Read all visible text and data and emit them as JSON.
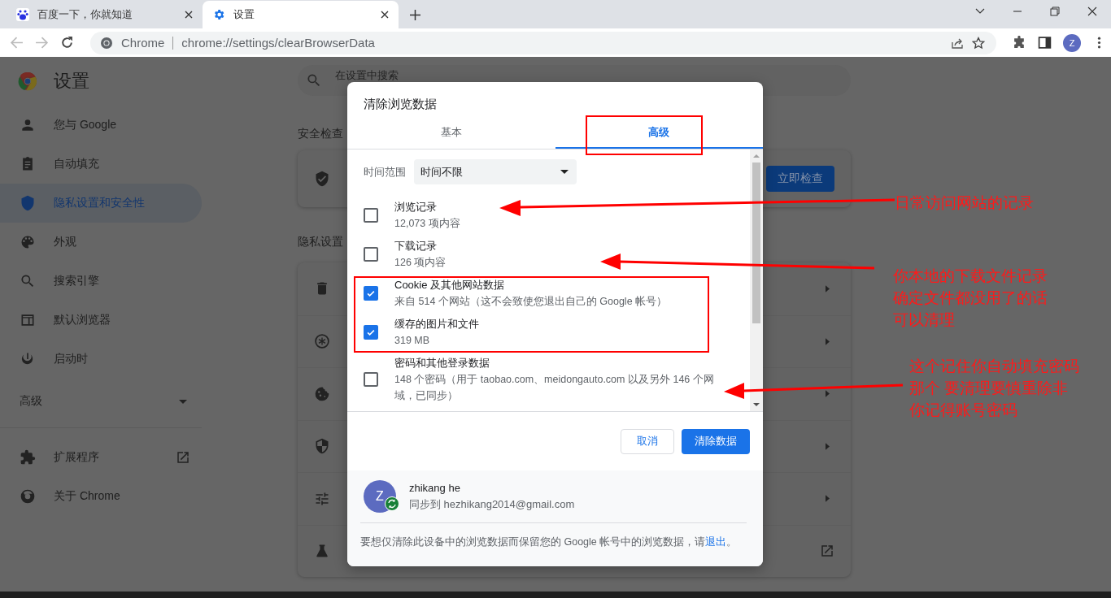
{
  "browser": {
    "tabs": [
      {
        "title": "百度一下，你就知道",
        "kind": "paw",
        "selected": false
      },
      {
        "title": "设置",
        "kind": "gear",
        "selected": true
      }
    ],
    "omnibox": {
      "site": "Chrome",
      "url": "chrome://settings/clearBrowserData"
    },
    "profile_initial": "Z"
  },
  "settings": {
    "title": "设置",
    "search": {
      "placeholder": "在设置中搜索"
    },
    "sidebar": {
      "items": [
        {
          "label": "您与 Google",
          "kind": "person",
          "selected": false
        },
        {
          "label": "自动填充",
          "kind": "clipboard",
          "selected": false
        },
        {
          "label": "隐私设置和安全性",
          "kind": "shield",
          "selected": true
        },
        {
          "label": "外观",
          "kind": "palette",
          "selected": false
        },
        {
          "label": "搜索引擎",
          "kind": "search",
          "selected": false
        },
        {
          "label": "默认浏览器",
          "kind": "browser",
          "selected": false
        },
        {
          "label": "启动时",
          "kind": "power",
          "selected": false
        }
      ],
      "advanced": {
        "label": "高级",
        "expanded": false
      },
      "links": [
        {
          "label": "扩展程序",
          "kind": "puzzle",
          "external": true
        },
        {
          "label": "关于 Chrome",
          "kind": "chrome",
          "external": false
        }
      ]
    },
    "safety_check": {
      "heading": "安全检查",
      "button": "立即检查"
    },
    "privacy": {
      "heading": "隐私设置",
      "rows": [
        {
          "kind": "trash",
          "external": false
        },
        {
          "kind": "asterisk",
          "external": false
        },
        {
          "kind": "cookie",
          "external": false
        },
        {
          "kind": "shield",
          "external": false
        },
        {
          "kind": "sliders",
          "external": false
        },
        {
          "kind": "flask",
          "external": true
        }
      ]
    }
  },
  "dialog": {
    "title": "清除浏览数据",
    "tabs": [
      {
        "label": "基本",
        "selected": false
      },
      {
        "label": "高级",
        "selected": true
      }
    ],
    "time_range": {
      "label": "时间范围",
      "value": "时间不限"
    },
    "items": [
      {
        "title": "浏览记录",
        "detail": "12,073 项内容",
        "checked": false
      },
      {
        "title": "下载记录",
        "detail": "126 项内容",
        "checked": false
      },
      {
        "title": "Cookie 及其他网站数据",
        "detail": "来自 514 个网站（这不会致使您退出自己的 Google 帐号）",
        "checked": true
      },
      {
        "title": "缓存的图片和文件",
        "detail": "319 MB",
        "checked": true
      },
      {
        "title": "密码和其他登录数据",
        "detail": "148 个密码（用于 taobao.com、meidongauto.com 以及另外 146 个网域，已同步）",
        "checked": false
      }
    ],
    "buttons": {
      "cancel": "取消",
      "confirm": "清除数据"
    },
    "account": {
      "initial": "Z",
      "name": "zhikang he",
      "sync": "同步到 hezhikang2014@gmail.com"
    },
    "note": {
      "before": "要想仅清除此设备中的浏览数据而保留您的 Google 帐号中的浏览数据，请",
      "link": "退出",
      "after": "。"
    }
  },
  "annotations": [
    {
      "lines": [
        "日常访问网站的记录"
      ]
    },
    {
      "lines": [
        "你本地的下载文件记录",
        "确定文件都没用了的话",
        "可以清理"
      ]
    },
    {
      "lines": [
        "这个记住你自动填充密码",
        "那个 要清理要慎重除非",
        "你记得账号密码"
      ]
    }
  ]
}
